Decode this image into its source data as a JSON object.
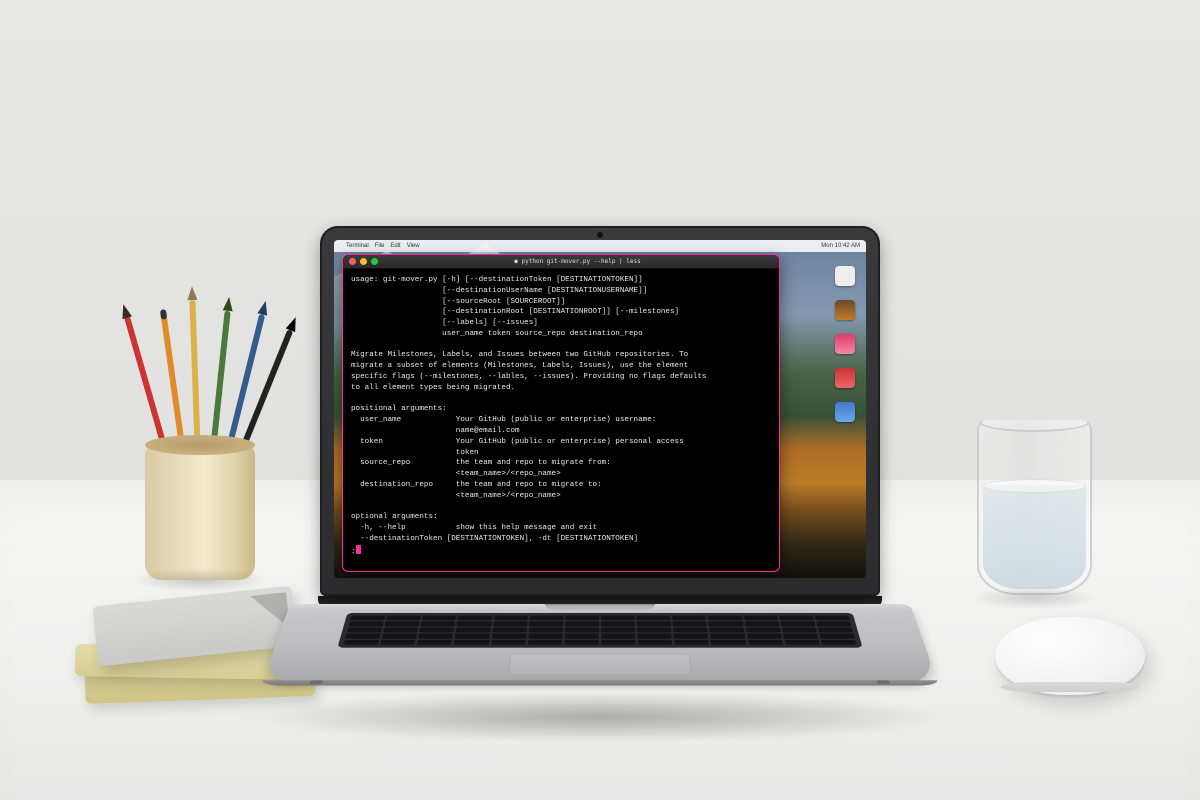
{
  "menubar": {
    "apple": "",
    "app": "Terminal",
    "items": [
      "File",
      "Edit",
      "View"
    ],
    "right": [
      "Mon 10:42 AM"
    ]
  },
  "desktop_icons": [
    {
      "name": "macintosh-hd"
    },
    {
      "name": "folder"
    },
    {
      "name": "image-1"
    },
    {
      "name": "image-2"
    },
    {
      "name": "image-3"
    }
  ],
  "terminal": {
    "title": "● python git-mover.py --help | less",
    "lines": [
      "usage: git-mover.py [-h] [--destinationToken [DESTINATIONTOKEN]]",
      "                    [--destinationUserName [DESTINATIONUSERNAME]]",
      "                    [--sourceRoot [SOURCEROOT]]",
      "                    [--destinationRoot [DESTINATIONROOT]] [--milestones]",
      "                    [--labels] [--issues]",
      "                    user_name token source_repo destination_repo",
      "",
      "Migrate Milestones, Labels, and Issues between two GitHub repositories. To",
      "migrate a subset of elements (Milestones, Labels, Issues), use the element",
      "specific flags (--milestones, --lables, --issues). Providing no flags defaults",
      "to all element types being migrated.",
      "",
      "positional arguments:",
      "  user_name            Your GitHub (public or enterprise) username:",
      "                       name@email.com",
      "  token                Your GitHub (public or enterprise) personal access",
      "                       token",
      "  source_repo          the team and repo to migrate from:",
      "                       <team_name>/<repo_name>",
      "  destination_repo     the team and repo to migrate to:",
      "                       <team_name>/<repo_name>",
      "",
      "optional arguments:",
      "  -h, --help           show this help message and exit",
      "  --destinationToken [DESTINATIONTOKEN], -dt [DESTINATIONTOKEN]"
    ],
    "prompt": ":"
  }
}
